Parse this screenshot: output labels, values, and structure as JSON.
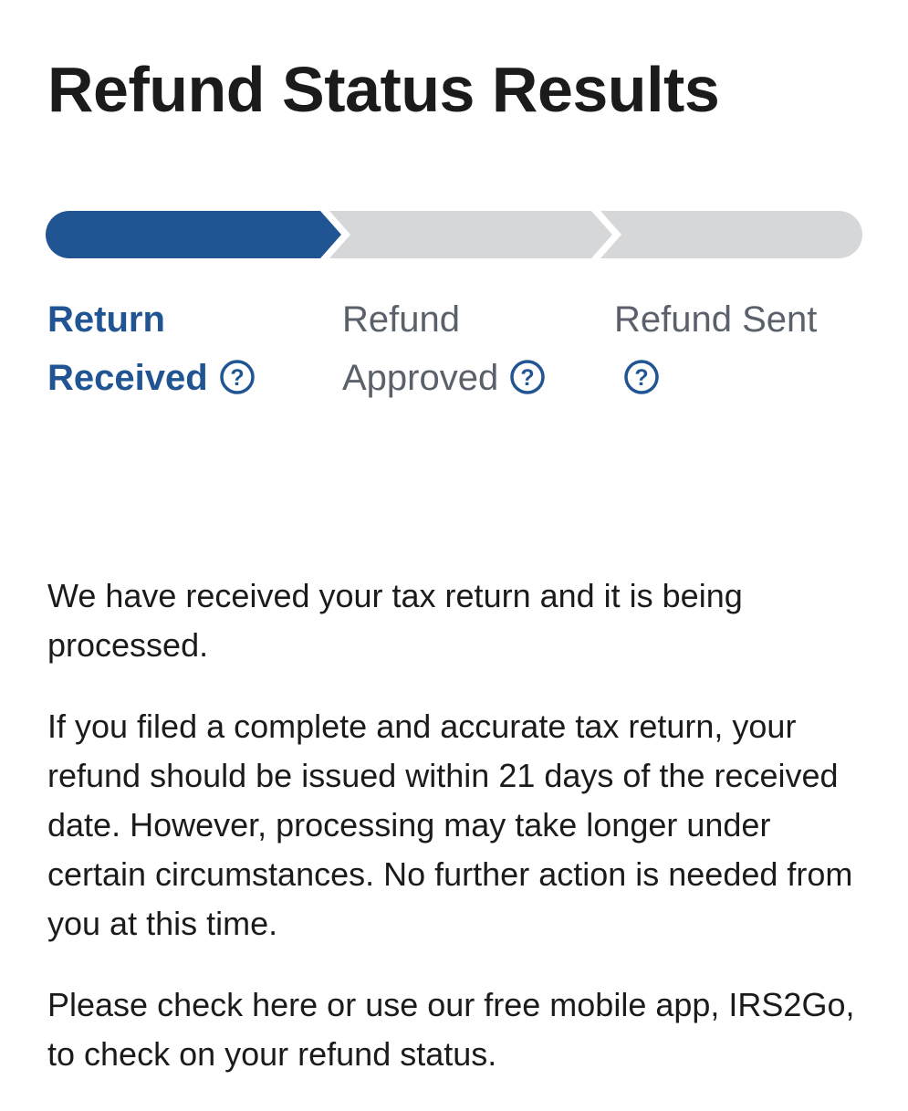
{
  "page": {
    "title": "Refund Status Results"
  },
  "progress": {
    "current_step": 1,
    "total_steps": 3,
    "active_color": "#205493",
    "inactive_color": "#d6d7d9"
  },
  "steps": [
    {
      "label_line1": "Return",
      "label_line2": "Received",
      "state": "active",
      "help_icon": "question-circle-icon"
    },
    {
      "label_line1": "Refund",
      "label_line2": "Approved",
      "state": "inactive",
      "help_icon": "question-circle-icon"
    },
    {
      "label_line1": "Refund Sent",
      "label_line2": "",
      "state": "inactive",
      "help_icon": "question-circle-icon"
    }
  ],
  "message": {
    "paragraph1": "We have received your tax return and it is being processed.",
    "paragraph2": "If you filed a complete and accurate tax return, your refund should be issued within 21 days of the received date. However, processing may take longer under certain circumstances. No further action is needed from you at this time.",
    "paragraph3": "Please check here or use our free mobile app, IRS2Go, to check on your refund status."
  }
}
